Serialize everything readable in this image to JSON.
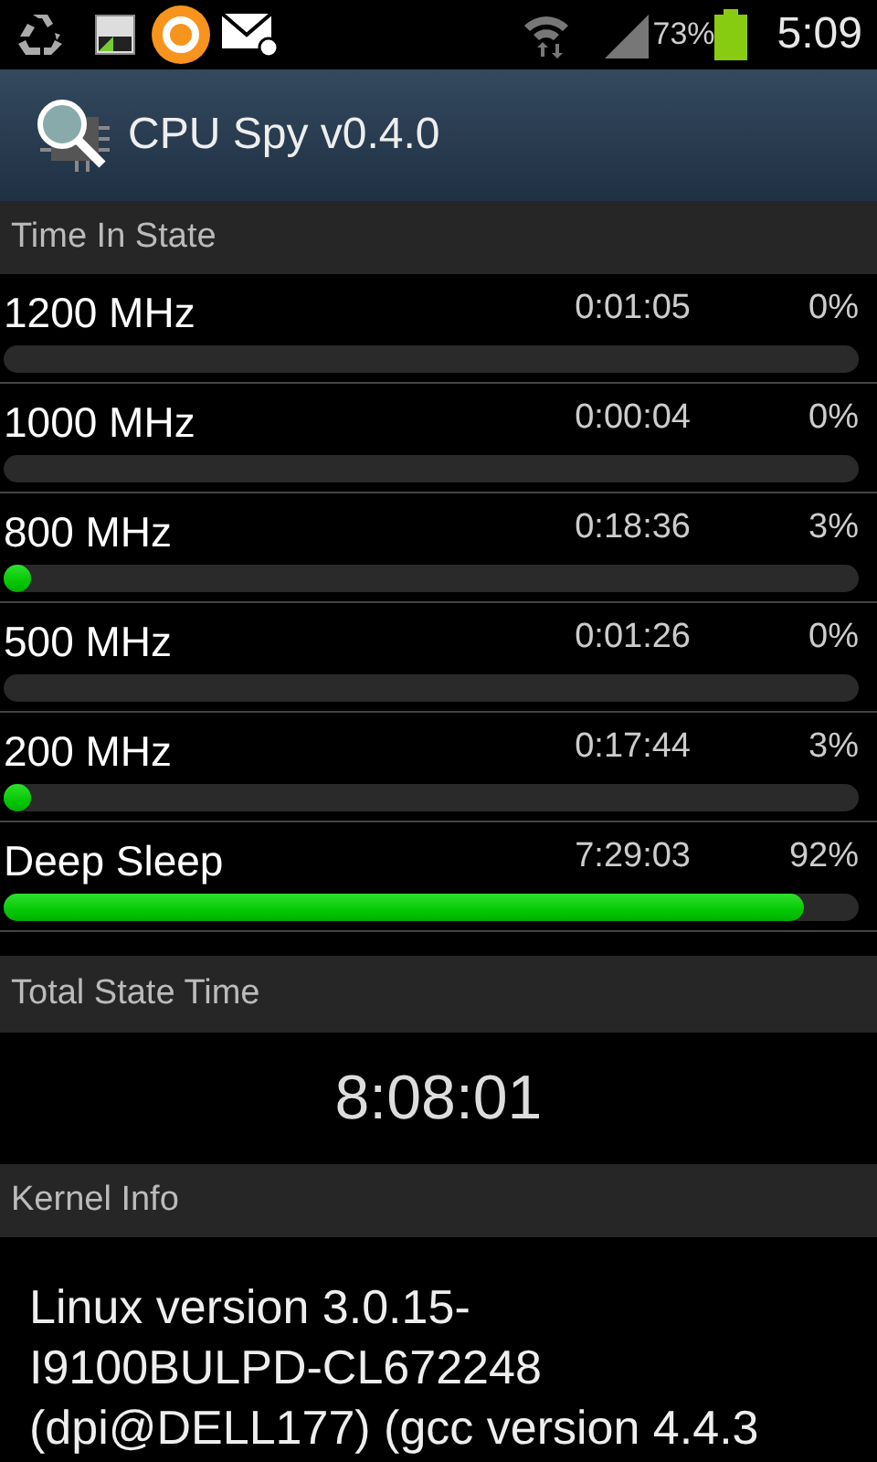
{
  "status_bar": {
    "battery": "73%",
    "time": "5:09"
  },
  "app_bar": {
    "title": "CPU Spy v0.4.0"
  },
  "time_in_state": {
    "header": "Time In State",
    "states": [
      {
        "name": "1200 MHz",
        "time": "0:01:05",
        "percent": "0%"
      },
      {
        "name": "1000 MHz",
        "time": "0:00:04",
        "percent": "0%"
      },
      {
        "name": "800 MHz",
        "time": "0:18:36",
        "percent": "3%",
        "level": 0.03
      },
      {
        "name": "500 MHz",
        "time": "0:01:26",
        "percent": "0%"
      },
      {
        "name": "200 MHz",
        "time": "0:17:44",
        "percent": "3%",
        "level": 0.03
      },
      {
        "name": "Deep Sleep",
        "time": "7:29:03",
        "percent": "92%",
        "level": 0.935
      }
    ]
  },
  "total_state_time": {
    "header": "Total State Time",
    "value": "8:08:01"
  },
  "kernel_info": {
    "header": "Kernel Info",
    "text": "Linux version 3.0.15-\nI9100BULPD-CL672248\n(dpi@DELL177) (gcc version 4.4.3"
  }
}
